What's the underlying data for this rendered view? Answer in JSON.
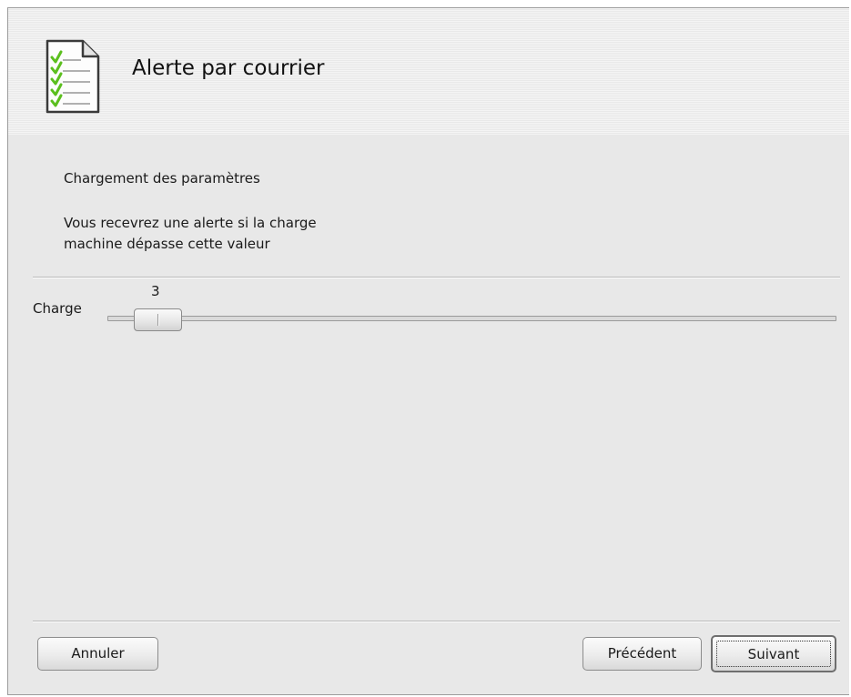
{
  "header": {
    "title": "Alerte par courrier",
    "icon": "checklist-document-icon",
    "icon_check_color": "#5bbf1e"
  },
  "content": {
    "section_title": "Chargement des paramètres",
    "description_line1": "Vous recevrez une alerte si la charge",
    "description_line2": "machine dépasse cette valeur"
  },
  "slider": {
    "label": "Charge",
    "value": "3",
    "value_fraction": 0.05
  },
  "buttons": {
    "cancel": "Annuler",
    "previous": "Précédent",
    "next": "Suivant"
  }
}
